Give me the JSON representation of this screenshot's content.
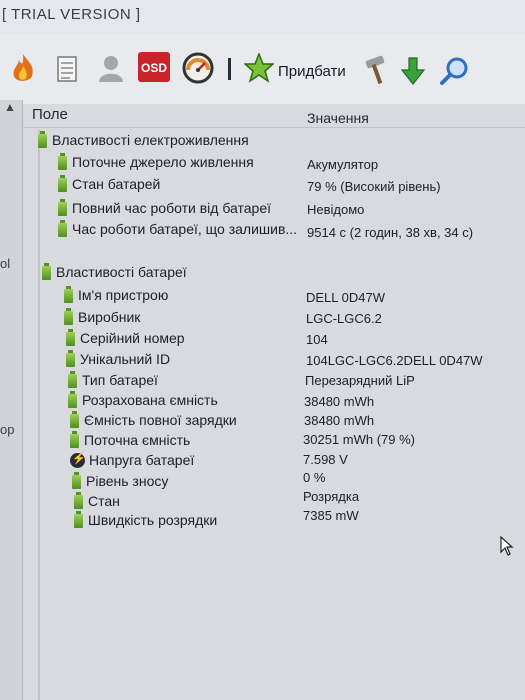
{
  "window": {
    "title": "[ TRIAL VERSION ]"
  },
  "toolbar": {
    "osd_label": "OSD",
    "add_label": "Придбати"
  },
  "edge": {
    "fragment_1": "ol",
    "fragment_2": "op"
  },
  "columns": {
    "field": "Поле",
    "value": "Значення"
  },
  "power_section": {
    "title": "Властивості електроживлення",
    "rows": [
      {
        "label": "Поточне джерело живлення",
        "value": "Акумулятор"
      },
      {
        "label": "Стан батарей",
        "value": "79 % (Високий рівень)"
      },
      {
        "label": "Повний час роботи від батареї",
        "value": "Невідомо"
      },
      {
        "label": "Час роботи батареї, що залишив...",
        "value": "9514 с (2 годин, 38 хв, 34 с)"
      }
    ]
  },
  "battery_section": {
    "title": "Властивості батареї",
    "rows": [
      {
        "label": "Ім'я пристрою",
        "value": "DELL 0D47W"
      },
      {
        "label": "Виробник",
        "value": "LGC-LGC6.2"
      },
      {
        "label": "Серійний номер",
        "value": "104"
      },
      {
        "label": "Унікальний ID",
        "value": "104LGC-LGC6.2DELL 0D47W"
      },
      {
        "label": "Тип батареї",
        "value": "Перезарядний LiP"
      },
      {
        "label": "Розрахована ємність",
        "value": "38480 mWh"
      },
      {
        "label": "Ємність повної зарядки",
        "value": "38480 mWh"
      },
      {
        "label": "Поточна ємність",
        "value": "30251 mWh  (79 %)"
      },
      {
        "label": "Напруга батареї",
        "value": "7.598 V"
      },
      {
        "label": "Рівень зносу",
        "value": "0 %"
      },
      {
        "label": "Стан",
        "value": "Розрядка"
      },
      {
        "label": "Швидкість розрядки",
        "value": "7385 mW"
      }
    ]
  },
  "icons": {
    "flame": "flame-icon",
    "report": "report-icon",
    "user": "user-icon",
    "osd": "osd-icon",
    "gauge": "gauge-icon",
    "add": "star-add-icon",
    "tools": "hammer-icon",
    "download": "download-arrow-icon",
    "search": "search-icon",
    "battery": "battery-icon",
    "voltage": "voltage-icon"
  },
  "colors": {
    "battery_green": "#5c9b24",
    "osd_red": "#c8242b",
    "download_green": "#3aa23a",
    "search_blue": "#2f6fc4"
  }
}
